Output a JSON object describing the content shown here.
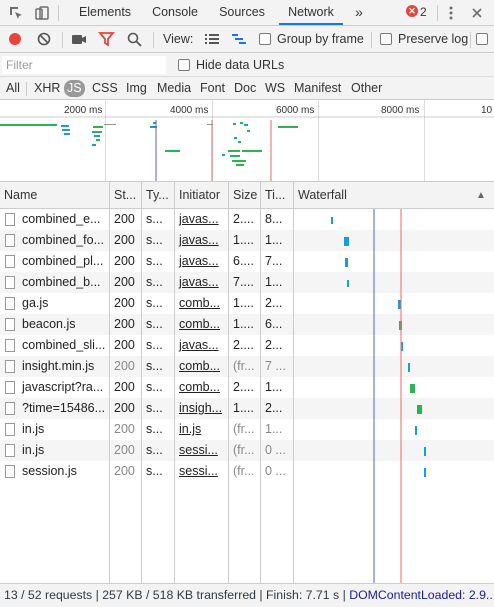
{
  "tabs": [
    "Elements",
    "Console",
    "Sources",
    "Network"
  ],
  "tabs_more": "»",
  "error_count": "2",
  "toolbar": {
    "view_label": "View:",
    "group_by_frame": "Group by frame",
    "preserve_log": "Preserve log"
  },
  "filter": {
    "placeholder": "Filter",
    "hide_data_urls": "Hide data URLs"
  },
  "types": [
    "All",
    "XHR",
    "JS",
    "CSS",
    "Img",
    "Media",
    "Font",
    "Doc",
    "WS",
    "Manifest",
    "Other"
  ],
  "overview_ticks": [
    "2000 ms",
    "4000 ms",
    "6000 ms",
    "8000 ms",
    "10"
  ],
  "columns": [
    "Name",
    "St...",
    "Ty...",
    "Initiator",
    "Size",
    "Ti...",
    "Waterfall"
  ],
  "sort_arrow": "▲",
  "rows": [
    {
      "name": "combined_e...",
      "status": "200",
      "type": "s...",
      "initiator": "javas...",
      "size": "2....",
      "time": "8...",
      "color": "#1a9cd8"
    },
    {
      "name": "combined_fo...",
      "status": "200",
      "type": "s...",
      "initiator": "javas...",
      "size": "1....",
      "time": "1...",
      "color": "#1a9cd8"
    },
    {
      "name": "combined_pl...",
      "status": "200",
      "type": "s...",
      "initiator": "javas...",
      "size": "6....",
      "time": "7...",
      "color": "#1a9cd8"
    },
    {
      "name": "combined_b...",
      "status": "200",
      "type": "s...",
      "initiator": "javas...",
      "size": "7....",
      "time": "1...",
      "color": "#1a9cd8"
    },
    {
      "name": "ga.js",
      "status": "200",
      "type": "s...",
      "initiator": "comb...",
      "size": "1....",
      "time": "2...",
      "color": "#1a9cd8"
    },
    {
      "name": "beacon.js",
      "status": "200",
      "type": "s...",
      "initiator": "comb...",
      "size": "1....",
      "time": "6...",
      "color": "#2bb552"
    },
    {
      "name": "combined_sli...",
      "status": "200",
      "type": "s...",
      "initiator": "javas...",
      "size": "2....",
      "time": "2...",
      "color": "#1a9cd8"
    },
    {
      "name": "insight.min.js",
      "status": "200",
      "type": "s...",
      "initiator": "comb...",
      "size": "(fr...",
      "time": "7 ...",
      "color": "#1a9cd8",
      "dim": true
    },
    {
      "name": "javascript?ra...",
      "status": "200",
      "type": "s...",
      "initiator": "comb...",
      "size": "2....",
      "time": "1...",
      "color": "#2bb552"
    },
    {
      "name": "?time=15486...",
      "status": "200",
      "type": "s...",
      "initiator": "insigh...",
      "size": "1....",
      "time": "2...",
      "color": "#2bb552"
    },
    {
      "name": "in.js",
      "status": "200",
      "type": "s...",
      "initiator": "in.js",
      "size": "(fr...",
      "time": "1...",
      "color": "#1a9cd8",
      "dim": true
    },
    {
      "name": "in.js",
      "status": "200",
      "type": "s...",
      "initiator": "sessi...",
      "size": "(fr...",
      "time": "0 ...",
      "color": "#1a9cd8",
      "dim": true
    },
    {
      "name": "session.js",
      "status": "200",
      "type": "s...",
      "initiator": "sessi...",
      "size": "(fr...",
      "time": "0 ...",
      "color": "#1a9cd8",
      "dim": true
    }
  ],
  "status_bar": {
    "summary": "13 / 52 requests | 257 KB / 518 KB transferred | Finish: 7.71 s | ",
    "dcl": "DOMContentLoaded: 2.9..."
  },
  "colors": {
    "record": "#e8443a",
    "filter_active": "#e8443a",
    "accent": "#1a73e8",
    "dom_content_loaded_line": "#5b5bd6",
    "load_line": "#e86a6a",
    "js_bar": "#1a9cd8",
    "green_bar": "#2bb552"
  }
}
